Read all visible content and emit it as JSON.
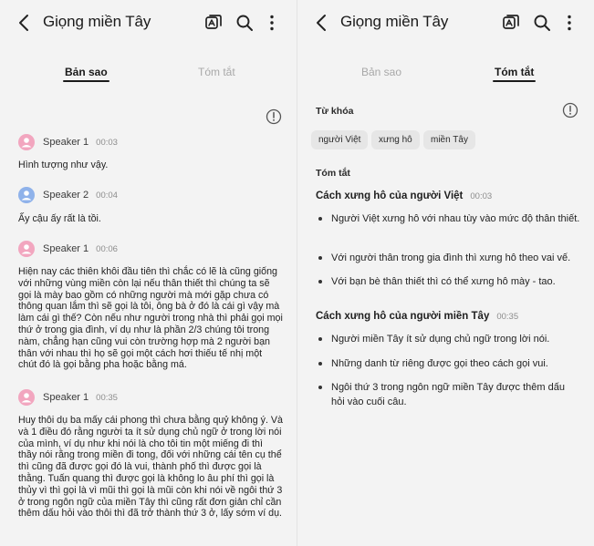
{
  "app": {
    "title": "Giọng miền Tây",
    "tabs": [
      "Bản sao",
      "Tóm tắt"
    ]
  },
  "colors": {
    "speaker1_avatar": "#f2a6bf",
    "speaker2_avatar": "#8fb2ea",
    "background": "#f3f3f3"
  },
  "icons": [
    "back-arrow-icon",
    "translate-icon",
    "search-icon",
    "more-vertical-icon",
    "info-icon",
    "person-icon"
  ],
  "transcript": [
    {
      "speaker": "Speaker 1",
      "time": "00:03",
      "text": "Hình tượng như vậy."
    },
    {
      "speaker": "Speaker 2",
      "time": "00:04",
      "text": "Ấy cậu ấy rất là tồi."
    },
    {
      "speaker": "Speaker 1",
      "time": "00:06",
      "text": "Hiện nay các thiên khôi đầu tiên thì chắc có lẽ là cũng giống với những vùng miền còn lại nếu thân thiết thì chúng ta sẽ gọi là mày bao gồm có những người mà mới gặp chưa có thông quan lắm thì sẽ gọi là tôi, ông bà ở đó là cái gì vậy mà làm cái gì thế? Còn nếu như người trong nhà thì phải gọi mọi thứ ở trong gia đình, ví dụ như là phần 2/3 chúng tôi trong nàm, chẳng hạn cũng vui còn trường hợp mà 2 người bạn thân với nhau thì họ sẽ gọi một cách hơi thiếu tế nhị một chút đó là gọi bằng pha hoặc bằng má."
    },
    {
      "speaker": "Speaker 1",
      "time": "00:35",
      "text": "Huy thôi dụ ba mấy cái phong thì chưa bằng quỷ không ý. Và và 1 điều đó rằng người ta ít sử dụng chủ ngữ ở trong lời nói của mình, ví dụ như khi nói là cho tôi tin một miếng đi thì thầy nói rằng trong miền đi tong, đối với những cái tên cụ thể thì cũng đã được gọi đó là vui, thành phố thì được gọi là thằng. Tuấn quang thì được gọi là không lo âu phí thì gọi là thủy vì thì gọi là vì mũi thì gọi là mũi còn khi nói về ngôi thứ 3 ở trong ngôn ngữ của miền Tây thì cũng rất đơn giản chỉ cần thêm dấu hỏi vào thôi thì đã trở thành thứ 3 ở, lấy sớm ví dụ."
    }
  ],
  "summary": {
    "keywords_label": "Từ khóa",
    "keywords": [
      "người Việt",
      "xưng hô",
      "miền Tây"
    ],
    "summary_label": "Tóm tắt",
    "sections": [
      {
        "heading": "Cách xưng hô của người Việt",
        "time": "00:03",
        "bullets": [
          "Người Việt xưng hô với nhau tùy vào mức độ thân thiết.",
          "Với người thân trong gia đình thì xưng hô theo vai vế.",
          "Với bạn bè thân thiết thì có thể xưng hô mày - tao."
        ]
      },
      {
        "heading": "Cách xưng hô của người miền Tây",
        "time": "00:35",
        "bullets": [
          "Người miền Tây ít sử dụng chủ ngữ trong lời nói.",
          "Những danh từ riêng được gọi theo cách gọi vui.",
          "Ngôi thứ 3 trong ngôn ngữ miền Tây được thêm dấu hỏi vào cuối câu."
        ]
      }
    ]
  }
}
